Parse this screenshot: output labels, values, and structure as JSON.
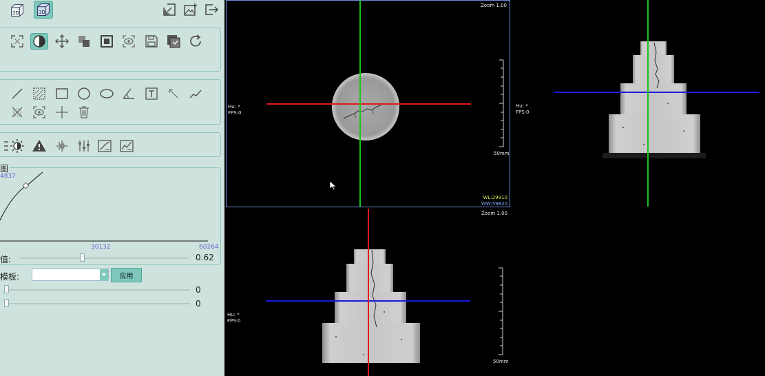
{
  "toolbar_top": {
    "btn_2d": "2D",
    "btn_3d": "3D",
    "icons_right": [
      "export-icon",
      "add-image-icon",
      "exit-icon"
    ]
  },
  "image_tools": [
    "fullscreen-icon",
    "contrast-icon",
    "pan-icon",
    "overlay-icon",
    "frame-icon",
    "view-icon",
    "save-icon",
    "save-copy-icon",
    "refresh-icon"
  ],
  "measure_tools": [
    "line-icon",
    "hatch-icon",
    "rectangle-icon",
    "circle-icon",
    "ellipse-icon",
    "angle-icon",
    "text-icon",
    "arrow-icon",
    "polyline-icon",
    "clear-measure-icon",
    "eye-icon",
    "cross-icon",
    "trash-icon"
  ],
  "filter_tools": [
    "brightness-icon",
    "warning-icon",
    "waveform-icon",
    "sliders-icon",
    "curve-chart-icon",
    "histogram-icon"
  ],
  "histogram": {
    "title_fragment": "图",
    "top_value": "4837",
    "mid_tick": "30132",
    "max_tick": "60264"
  },
  "gamma": {
    "label_fragment": "值:",
    "value": "0.62",
    "slider_position": 0.37
  },
  "template": {
    "label_fragment": "模板:",
    "selected": "",
    "apply_button": "应用"
  },
  "slider_a": {
    "value": "0",
    "slider_position": 0.0
  },
  "slider_b": {
    "value": "0",
    "slider_position": 0.0
  },
  "viewports": {
    "axial": {
      "zoom": "Zoom 1.00",
      "hu": "Hu: *",
      "fps": "FPS:0",
      "scale": "50mm",
      "wl": "WL:29910",
      "ww": "WW:59820"
    },
    "sagittal": {
      "hu": "Hu: *",
      "fps": "FPS:0"
    },
    "coronal": {
      "zoom": "Zoom 1.00",
      "hu": "Hu: *",
      "fps": "FPS:0",
      "scale": "50mm"
    }
  },
  "colors": {
    "panel_bg": "#cfe3de",
    "accent": "#7ec9bb",
    "crosshair_red": "#e01818",
    "crosshair_green": "#1cc41c",
    "crosshair_blue": "#1a1ae0",
    "active_viewport_border": "#6a8fd8"
  }
}
